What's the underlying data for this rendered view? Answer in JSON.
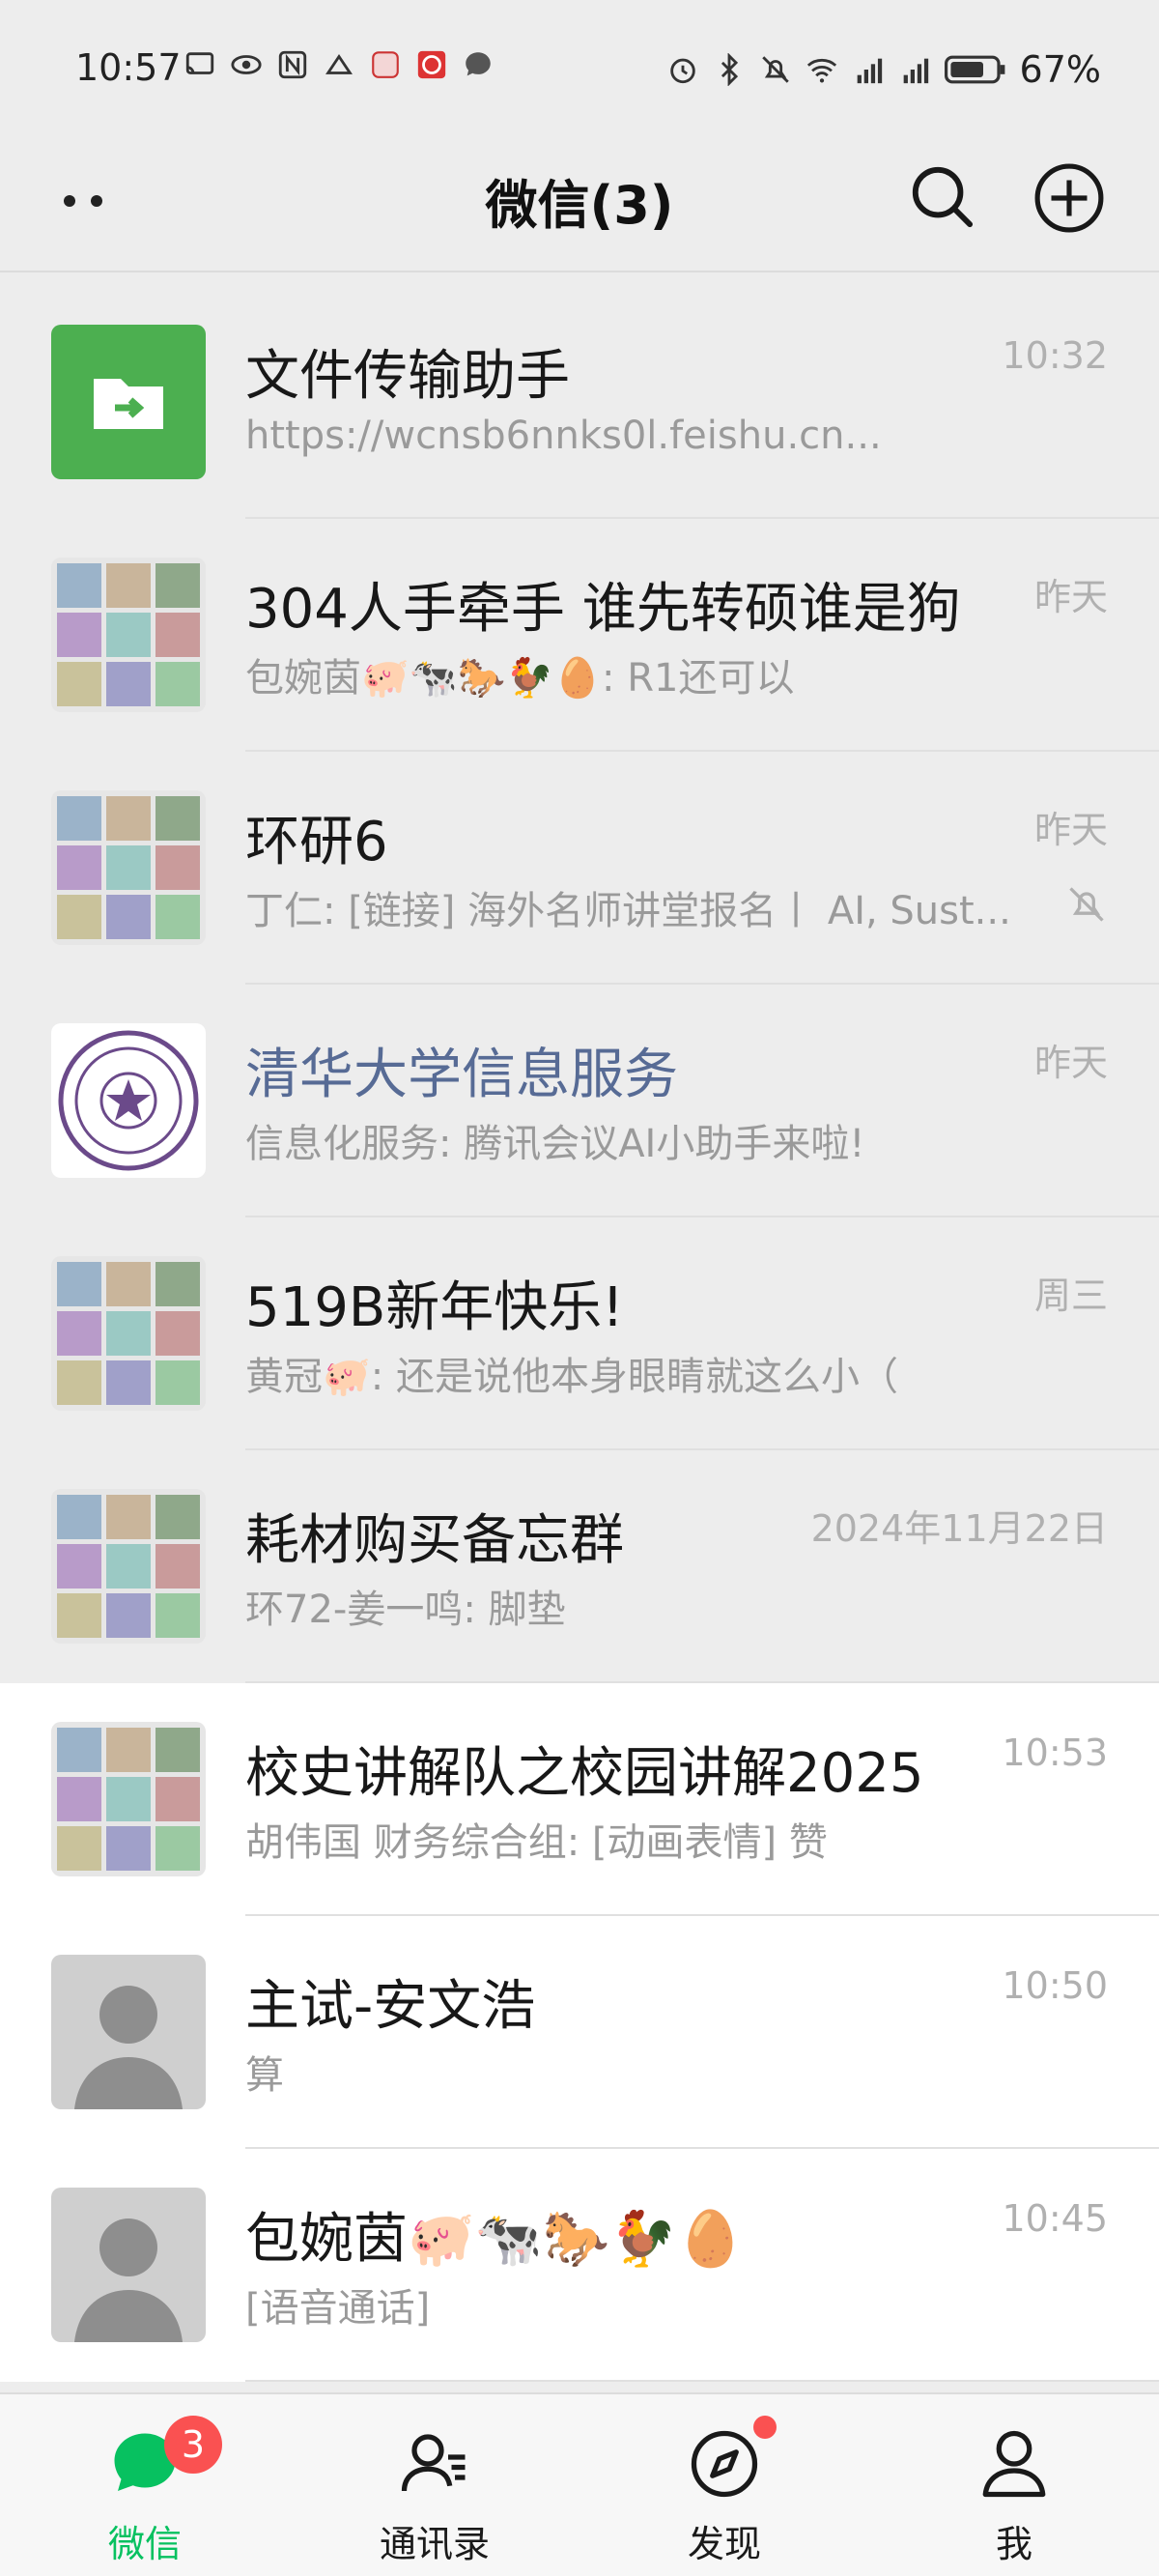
{
  "status_bar": {
    "time": "10:57",
    "battery": "67%",
    "icons_left": [
      "cast-icon",
      "eye-icon",
      "nfc-icon",
      "app-icon",
      "app-icon",
      "app-icon",
      "chat-bubble-icon"
    ],
    "icons_right": [
      "alarm-icon",
      "bluetooth-icon",
      "silent-icon",
      "wifi-icon",
      "signal-5g-icon",
      "signal-5g-icon",
      "battery-icon"
    ]
  },
  "header": {
    "title": "微信(3)"
  },
  "chats": [
    {
      "name": "文件传输助手",
      "preview": "https://wcnsb6nnks0l.feishu.cn...",
      "time": "10:32",
      "pinned": true,
      "avatar": "file-transfer-icon",
      "official": false,
      "muted": false
    },
    {
      "name": "304人手牵手 谁先转硕谁是狗",
      "preview": "包婉茵🐖🐄🐎🐓🥚: R1还可以",
      "time": "昨天",
      "pinned": true,
      "avatar": "group-avatar",
      "official": false,
      "muted": false
    },
    {
      "name": "环研6",
      "preview": "丁仁: [链接] 海外名师讲堂报名丨 AI, Sust...",
      "time": "昨天",
      "pinned": true,
      "avatar": "group-avatar",
      "official": false,
      "muted": true
    },
    {
      "name": "清华大学信息服务",
      "preview": "信息化服务: 腾讯会议AI小助手来啦!",
      "time": "昨天",
      "pinned": true,
      "avatar": "university-seal",
      "official": true,
      "muted": false
    },
    {
      "name": "519B新年快乐!",
      "preview": "黄冠🐖: 还是说他本身眼睛就这么小（",
      "time": "周三",
      "pinned": true,
      "avatar": "group-avatar",
      "official": false,
      "muted": false
    },
    {
      "name": "耗材购买备忘群",
      "preview": "环72-姜一鸣: 脚垫",
      "time": "2024年11月22日",
      "pinned": true,
      "avatar": "group-avatar",
      "official": false,
      "muted": false
    },
    {
      "name": "校史讲解队之校园讲解2025",
      "preview": "胡伟国 财务综合组: [动画表情] 赞",
      "time": "10:53",
      "pinned": false,
      "avatar": "group-avatar",
      "official": false,
      "muted": false
    },
    {
      "name": "主试-安文浩",
      "preview": "算",
      "time": "10:50",
      "pinned": false,
      "avatar": "user-avatar",
      "official": false,
      "muted": false
    },
    {
      "name": "包婉茵🐖🐄🐎🐓🥚",
      "preview": "[语音通话]",
      "time": "10:45",
      "pinned": false,
      "avatar": "user-avatar",
      "official": false,
      "muted": false
    }
  ],
  "tabs": [
    {
      "label": "微信",
      "icon": "chat-icon",
      "badge": "3",
      "active": true
    },
    {
      "label": "通讯录",
      "icon": "contacts-icon",
      "badge": "",
      "active": false
    },
    {
      "label": "发现",
      "icon": "compass-icon",
      "badge": "",
      "reddot": true,
      "active": false
    },
    {
      "label": "我",
      "icon": "person-icon",
      "badge": "",
      "active": false
    }
  ],
  "colors": {
    "accent": "#07c160",
    "official_name": "#576b95",
    "badge": "#fa5151",
    "pinned_bg": "#ededed"
  }
}
